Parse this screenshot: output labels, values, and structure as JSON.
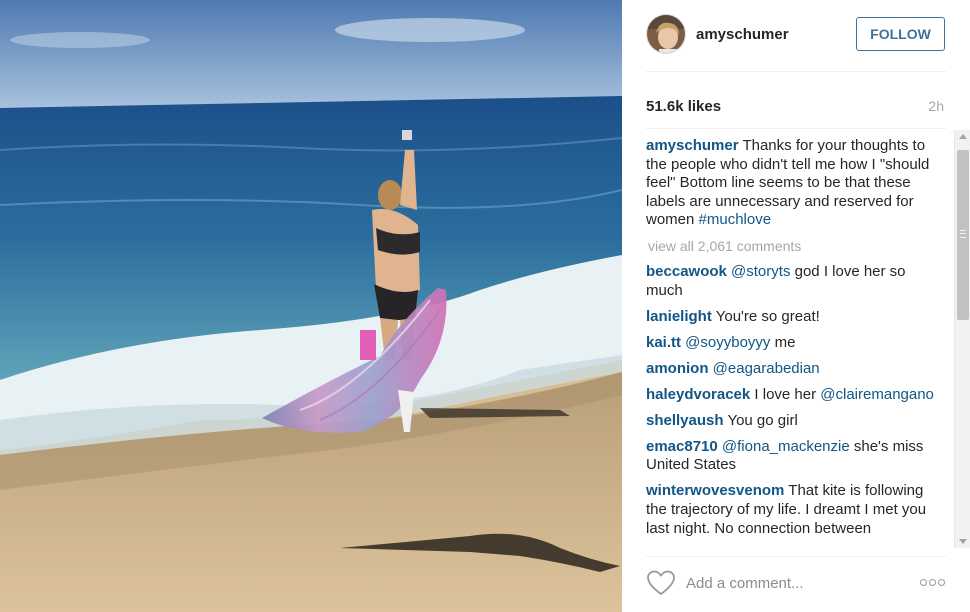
{
  "post": {
    "username": "amyschumer",
    "follow_label": "FOLLOW",
    "likes": "51.6k likes",
    "time_ago": "2h",
    "caption": {
      "user": "amyschumer",
      "text": " Thanks for your thoughts to the people who didn't tell me how I \"should feel\" Bottom line seems to be that these labels are unnecessary and reserved for women ",
      "hashtag": "#muchlove"
    },
    "view_all_comments": "view all 2,061 comments"
  },
  "comments": [
    {
      "user": "beccawook",
      "tag": " @storyts",
      "text": " god I love her so much"
    },
    {
      "user": "lanielight",
      "tag": "",
      "text": " You're so great!"
    },
    {
      "user": "kai.tt",
      "tag": " @soyyboyyy",
      "text": " me"
    },
    {
      "user": "amonion",
      "tag": " @eagarabedian",
      "text": ""
    },
    {
      "user": "haleydvoracek",
      "tag": "",
      "text": " I love her ",
      "tag_after": "@clairemangano"
    },
    {
      "user": "shellyaush",
      "tag": "",
      "text": " You go girl"
    },
    {
      "user": "emac8710",
      "tag": " @fiona_mackenzie",
      "text": " she's miss United States"
    },
    {
      "user": "winterwovesvenom",
      "tag": "",
      "text": " That kite is following the trajectory of my life. I dreamt I met you last night. No connection between"
    }
  ],
  "footer": {
    "add_comment_placeholder": "Add a comment..."
  },
  "icons": {
    "heart": "heart-outline-icon",
    "more": "more-options-icon"
  },
  "colors": {
    "link_blue": "#125688",
    "follow_blue": "#3f729b",
    "muted_gray": "#a5a7aa"
  }
}
